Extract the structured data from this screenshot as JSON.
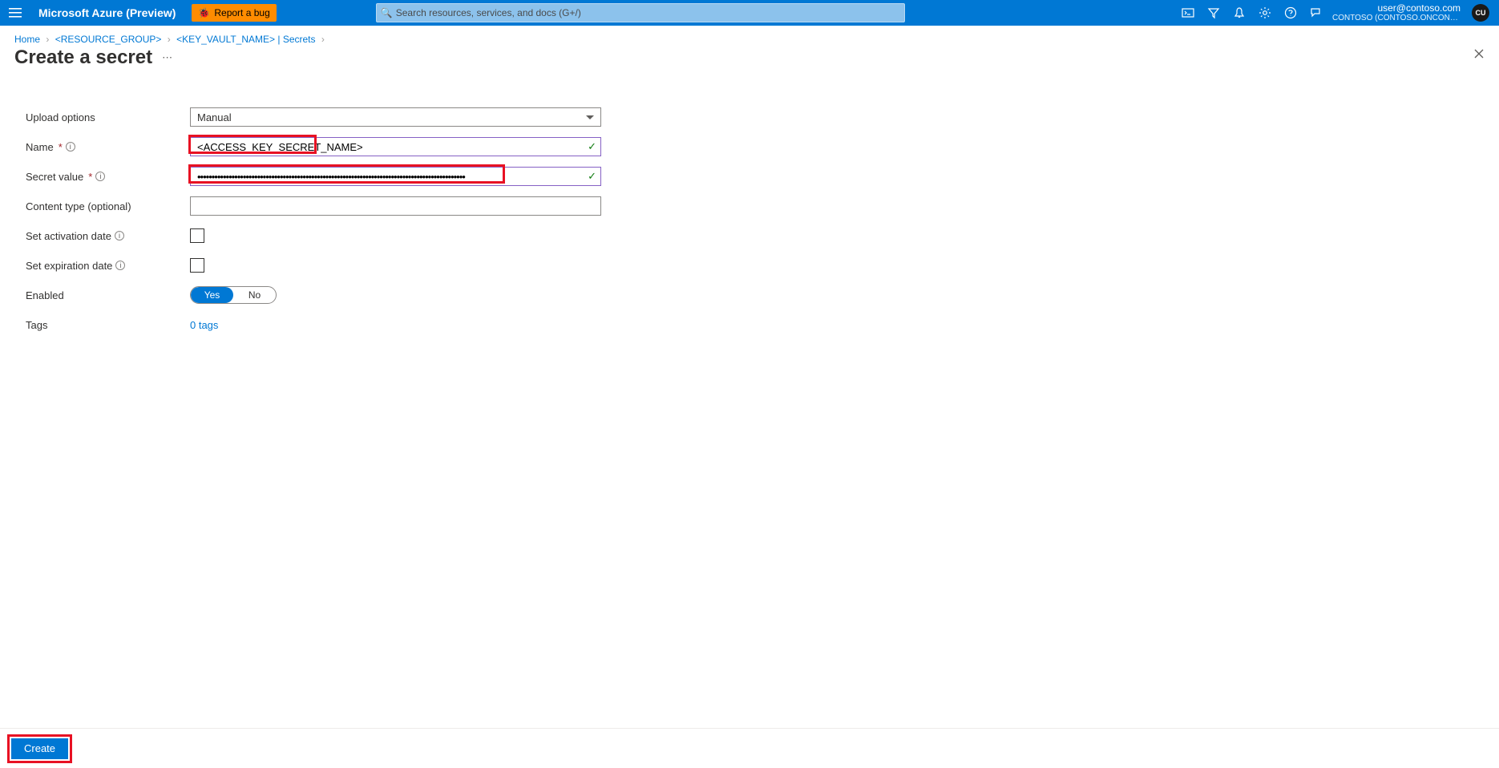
{
  "header": {
    "brand": "Microsoft Azure (Preview)",
    "report_bug": "Report a bug",
    "search_placeholder": "Search resources, services, and docs (G+/)"
  },
  "account": {
    "email": "user@contoso.com",
    "tenant": "CONTOSO (CONTOSO.ONCONTO...",
    "avatar_initials": "CU"
  },
  "breadcrumb": {
    "home": "Home",
    "rg": "<RESOURCE_GROUP>",
    "kv": "<KEY_VAULT_NAME>",
    "secrets_suffix": " | Secrets"
  },
  "page": {
    "title": "Create a secret"
  },
  "form": {
    "upload_options": {
      "label": "Upload options",
      "value": "Manual"
    },
    "name": {
      "label": "Name",
      "value": "<ACCESS_KEY_SECRET_NAME>"
    },
    "secret_value": {
      "label": "Secret value",
      "value_masked": "••••••••••••••••••••••••••••••••••••••••••••••••••••••••••••••••••••••••••••••••••••••••••••••"
    },
    "content_type": {
      "label": "Content type (optional)",
      "value": ""
    },
    "activation_date": {
      "label": "Set activation date",
      "checked": false
    },
    "expiration_date": {
      "label": "Set expiration date",
      "checked": false
    },
    "enabled": {
      "label": "Enabled",
      "yes": "Yes",
      "no": "No",
      "value": "Yes"
    },
    "tags": {
      "label": "Tags",
      "link": "0 tags"
    }
  },
  "footer": {
    "create": "Create"
  }
}
